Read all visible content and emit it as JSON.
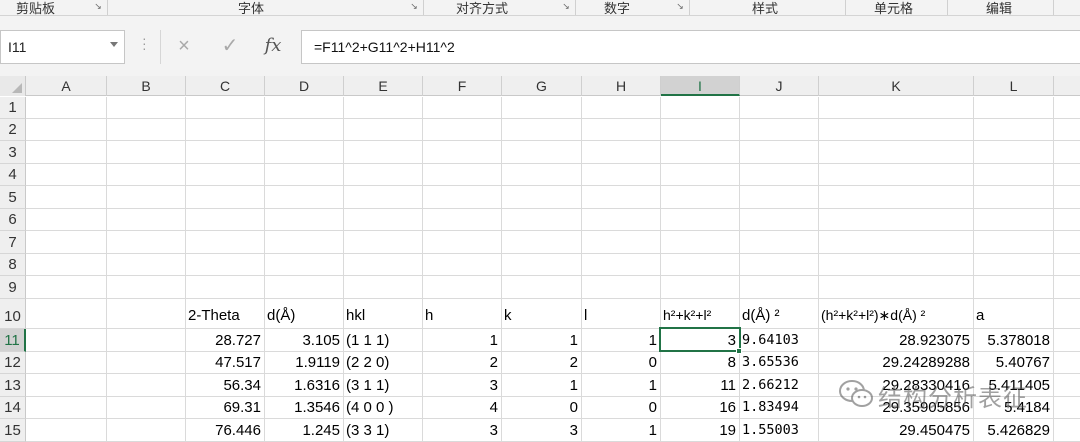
{
  "ribbon_groups": [
    {
      "label": "剪贴板",
      "launcher": true
    },
    {
      "label": "字体",
      "launcher": true
    },
    {
      "label": "对齐方式",
      "launcher": true
    },
    {
      "label": "数字",
      "launcher": true
    },
    {
      "label": "样式",
      "launcher": false
    },
    {
      "label": "单元格",
      "launcher": false
    },
    {
      "label": "编辑",
      "launcher": false
    }
  ],
  "formula_bar": {
    "name_box": "I11",
    "formula": "=F11^2+G11^2+H11^2",
    "cancel_icon": "×",
    "enter_icon": "✓",
    "fx_label": "fx"
  },
  "columns": [
    "A",
    "B",
    "C",
    "D",
    "E",
    "F",
    "G",
    "H",
    "I",
    "J",
    "K",
    "L"
  ],
  "selected_column": "I",
  "rows": [
    "1",
    "2",
    "3",
    "4",
    "5",
    "6",
    "7",
    "8",
    "9",
    "10",
    "11",
    "12",
    "13",
    "14",
    "15"
  ],
  "selected_row": "11",
  "active_cell": "I11",
  "header_row": {
    "C": "2-Theta",
    "D": "d(Å)",
    "E": "hkl",
    "F": "h",
    "G": "k",
    "H": "l",
    "I": "h²+k²+l²",
    "J": "d(Å) ²",
    "K": "(h²+k²+l²)∗d(Å) ²",
    "L": "a"
  },
  "data_rows": [
    {
      "row": "11",
      "C": "28.727",
      "D": "3.105",
      "E": "(1 1 1)",
      "F": "1",
      "G": "1",
      "H": "1",
      "I": "3",
      "J": "9.64103",
      "K": "28.923075",
      "L": "5.378018"
    },
    {
      "row": "12",
      "C": "47.517",
      "D": "1.9119",
      "E": "(2 2 0)",
      "F": "2",
      "G": "2",
      "H": "0",
      "I": "8",
      "J": "3.65536",
      "K": "29.24289288",
      "L": "5.40767"
    },
    {
      "row": "13",
      "C": "56.34",
      "D": "1.6316",
      "E": "(3 1 1)",
      "F": "3",
      "G": "1",
      "H": "1",
      "I": "11",
      "J": "2.66212",
      "K": "29.28330416",
      "L": "5.411405"
    },
    {
      "row": "14",
      "C": "69.31",
      "D": "1.3546",
      "E": "(4 0 0 )",
      "F": "4",
      "G": "0",
      "H": "0",
      "I": "16",
      "J": "1.83494",
      "K": "29.35905856",
      "L": "5.4184"
    },
    {
      "row": "15",
      "C": "76.446",
      "D": "1.245",
      "E": "(3 3 1)",
      "F": "3",
      "G": "3",
      "H": "1",
      "I": "19",
      "J": "1.55003",
      "K": "29.450475",
      "L": "5.426829"
    }
  ],
  "watermark": {
    "text": "结构分析表征",
    "icon": "wechat-logo"
  }
}
